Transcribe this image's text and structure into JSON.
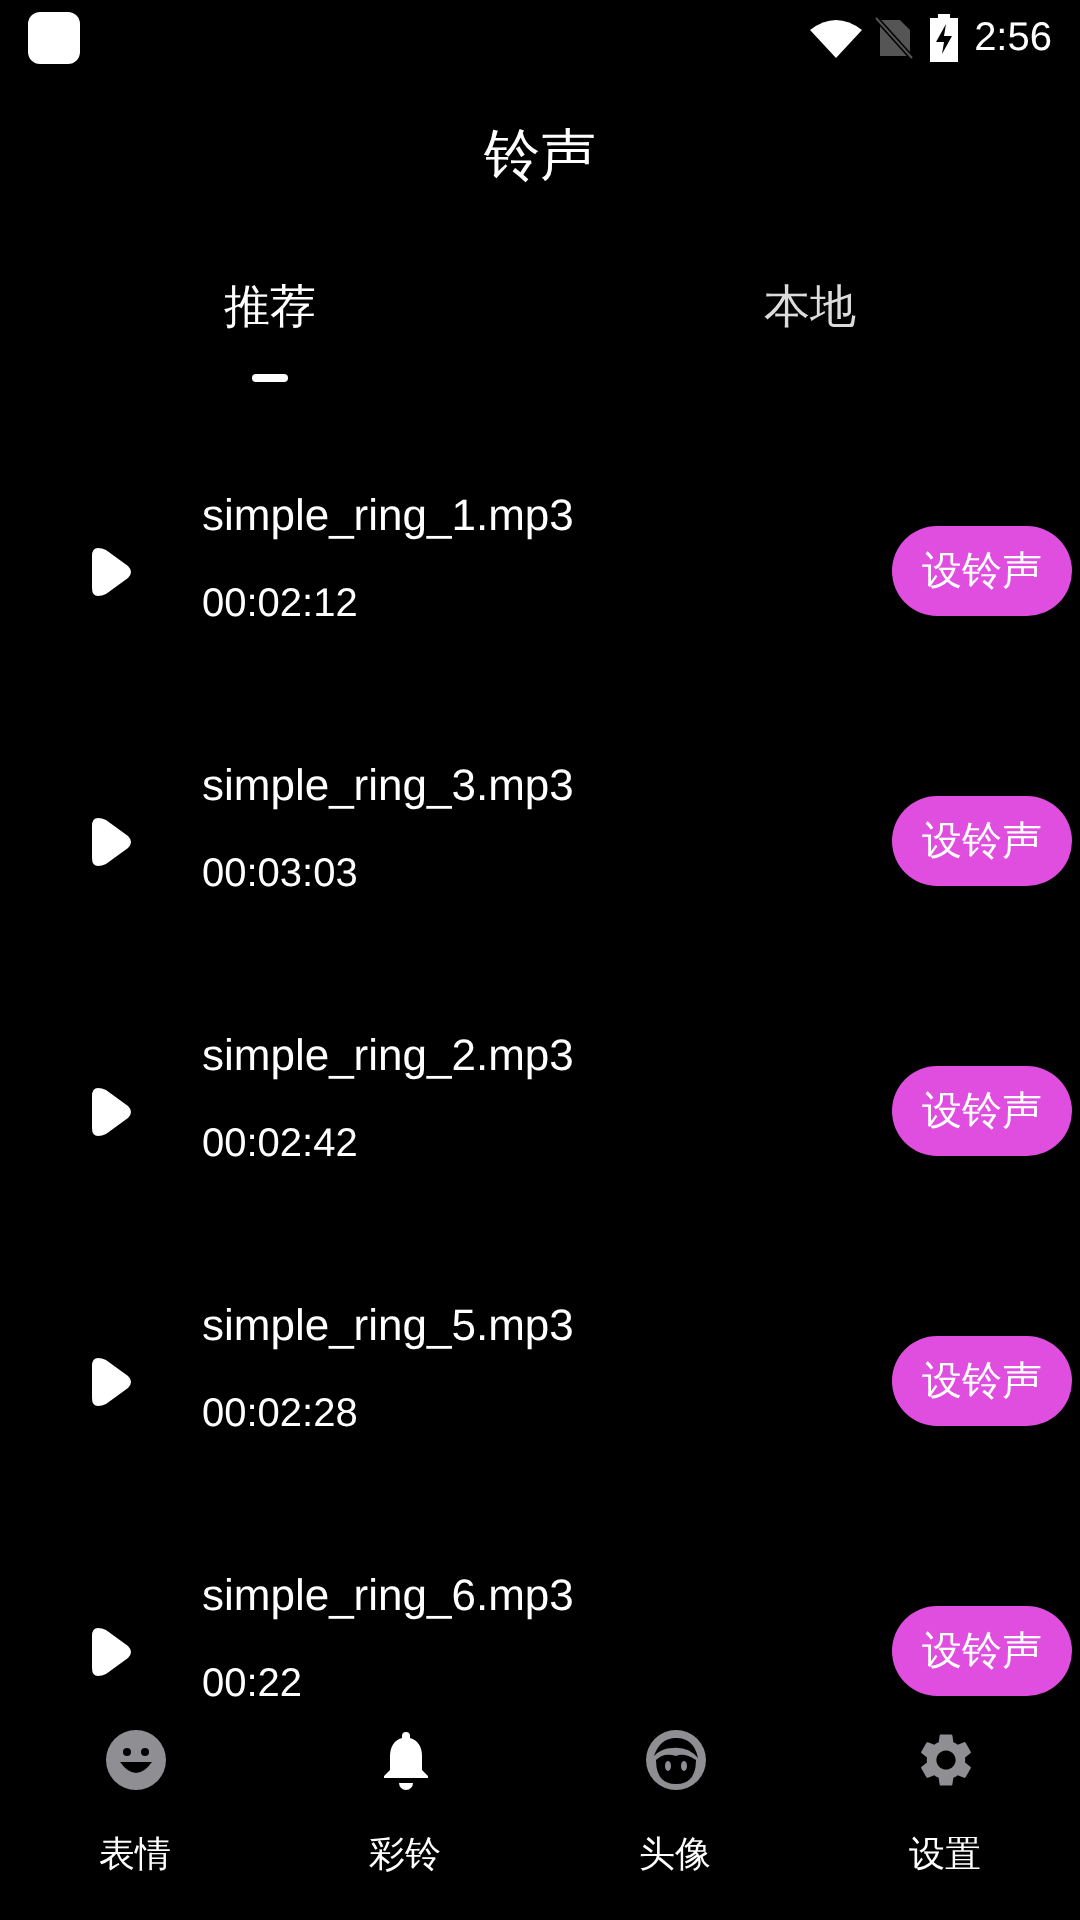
{
  "status_bar": {
    "time": "2:56"
  },
  "title": "铃声",
  "tabs": [
    {
      "label": "推荐",
      "selected": true
    },
    {
      "label": "本地",
      "selected": false
    }
  ],
  "ringtones": [
    {
      "name": "simple_ring_1.mp3",
      "duration": "00:02:12",
      "action": "设铃声"
    },
    {
      "name": "simple_ring_3.mp3",
      "duration": "00:03:03",
      "action": "设铃声"
    },
    {
      "name": "simple_ring_2.mp3",
      "duration": "00:02:42",
      "action": "设铃声"
    },
    {
      "name": "simple_ring_5.mp3",
      "duration": "00:02:28",
      "action": "设铃声"
    },
    {
      "name": "simple_ring_6.mp3",
      "duration": "00:22",
      "action": "设铃声"
    }
  ],
  "bottom_nav": [
    {
      "label": "表情",
      "kind": "emoji",
      "selected": false
    },
    {
      "label": "彩铃",
      "kind": "bell",
      "selected": true
    },
    {
      "label": "头像",
      "kind": "avatar",
      "selected": false
    },
    {
      "label": "设置",
      "kind": "settings",
      "selected": false
    }
  ]
}
